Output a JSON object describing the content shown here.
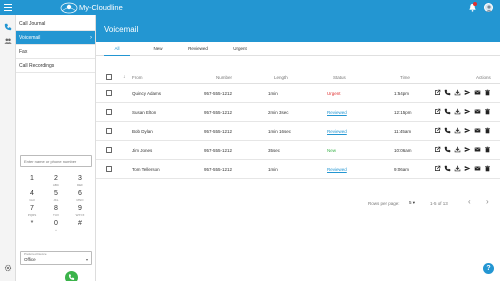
{
  "app": {
    "brand": "My-Cloudline"
  },
  "colors": {
    "primary": "#2396d2",
    "urgent": "#e03030",
    "new": "#3bb34a",
    "call": "#3bb34a"
  },
  "sidebar": {
    "items": [
      {
        "label": "Call Journal"
      },
      {
        "label": "Voicemail",
        "chevron": "›"
      },
      {
        "label": "Fax"
      },
      {
        "label": "Call Recordings"
      }
    ]
  },
  "dialer": {
    "placeholder": "Enter name or phone number",
    "keys": [
      {
        "d": "1",
        "l": ""
      },
      {
        "d": "2",
        "l": "ABC"
      },
      {
        "d": "3",
        "l": "DEF"
      },
      {
        "d": "4",
        "l": "GHI"
      },
      {
        "d": "5",
        "l": "JKL"
      },
      {
        "d": "6",
        "l": "MNO"
      },
      {
        "d": "7",
        "l": "PQRS"
      },
      {
        "d": "8",
        "l": "TUV"
      },
      {
        "d": "9",
        "l": "WXYZ"
      },
      {
        "d": "*",
        "l": ""
      },
      {
        "d": "0",
        "l": "+"
      },
      {
        "d": "#",
        "l": ""
      }
    ],
    "caller_id_label": "Preferred Device",
    "caller_id_value": "Office",
    "caller_id_arrow": "▾"
  },
  "main": {
    "title": "Voicemail",
    "tabs": [
      {
        "label": "All"
      },
      {
        "label": "New"
      },
      {
        "label": "Reviewed"
      },
      {
        "label": "Urgent"
      }
    ],
    "columns": {
      "sort": "↓",
      "from": "From",
      "number": "Number",
      "length": "Length",
      "status": "Status",
      "time": "Time",
      "actions": "Actions"
    },
    "rows": [
      {
        "from": "Quincy Adams",
        "number": "957-555-1212",
        "length": "1min",
        "status": "Urgent",
        "status_type": "urgent",
        "time": "1:54pm"
      },
      {
        "from": "Susan Elton",
        "number": "957-555-1212",
        "length": "2min 3sec",
        "status": "Reviewed",
        "status_type": "reviewed",
        "time": "12:15pm"
      },
      {
        "from": "Bob Dylan",
        "number": "957-555-1212",
        "length": "1min 16sec",
        "status": "Reviewed",
        "status_type": "reviewed",
        "time": "11:45am"
      },
      {
        "from": "Jim Jones",
        "number": "957-555-1212",
        "length": "35sec",
        "status": "New",
        "status_type": "new",
        "time": "10:06am"
      },
      {
        "from": "Tom Tellerson",
        "number": "957-555-1212",
        "length": "1min",
        "status": "Reviewed",
        "status_type": "reviewed",
        "time": "9:06am"
      }
    ],
    "action_icons": [
      "open-external-icon",
      "phone-icon",
      "download-icon",
      "send-icon",
      "email-icon",
      "trash-icon"
    ]
  },
  "pager": {
    "label": "Rows per page:",
    "rows_per_page": "5 ▾",
    "range": "1-5 of 13",
    "prev": "‹",
    "next": "›"
  },
  "help": {
    "label": "?"
  }
}
